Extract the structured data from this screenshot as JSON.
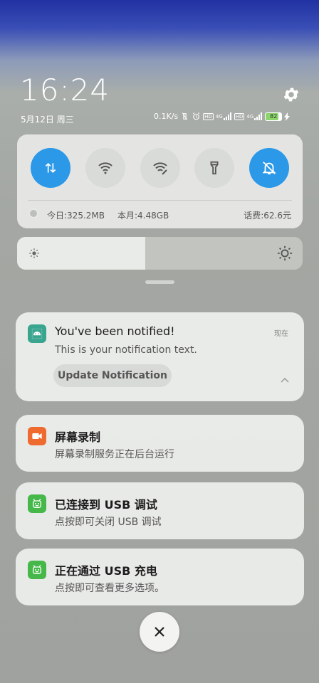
{
  "header": {
    "time": "16:24",
    "date": "5月12日 周三",
    "net_speed": "0.1K/s",
    "sim1_label": "HD",
    "sim1_net": "4G",
    "sim2_label": "HD",
    "sim2_net": "4G",
    "battery_level": "82",
    "icons": [
      "gear-icon",
      "mute-vibrate-icon",
      "alarm-icon",
      "signal-icon",
      "battery-icon",
      "charging-bolt-icon"
    ]
  },
  "quick_settings": {
    "tiles": [
      {
        "name": "mobile-data",
        "icon": "data-arrows-icon",
        "state": "on"
      },
      {
        "name": "wifi",
        "icon": "wifi-icon",
        "state": "off"
      },
      {
        "name": "hotspot",
        "icon": "wifi-edit-icon",
        "state": "off"
      },
      {
        "name": "flashlight",
        "icon": "flashlight-icon",
        "state": "off"
      },
      {
        "name": "mute",
        "icon": "bell-off-icon",
        "state": "on"
      }
    ],
    "data_today": "今日:325.2MB",
    "data_month": "本月:4.48GB",
    "balance": "话费:62.6元"
  },
  "brightness": {
    "level": 0.45
  },
  "notifications": [
    {
      "title": "You've been notified!",
      "text": "This is your notification text.",
      "time": "现在",
      "action": "Update Notification",
      "icon": "android-icon",
      "icon_color": "#3aa58f"
    },
    {
      "title": "屏幕录制",
      "text": "屏幕录制服务正在后台运行",
      "icon": "video-camera-icon",
      "icon_color": "#ef6a2e"
    },
    {
      "title": "已连接到 USB 调试",
      "text": "点按即可关闭 USB 调试",
      "icon": "usb-bot-icon",
      "icon_color": "#46b84a"
    },
    {
      "title": "正在通过 USB 充电",
      "text": "点按即可查看更多选项。",
      "icon": "usb-bot-icon",
      "icon_color": "#46b84a"
    }
  ],
  "colors": {
    "accent": "#2c98e8",
    "panel": "#e8eae7"
  }
}
